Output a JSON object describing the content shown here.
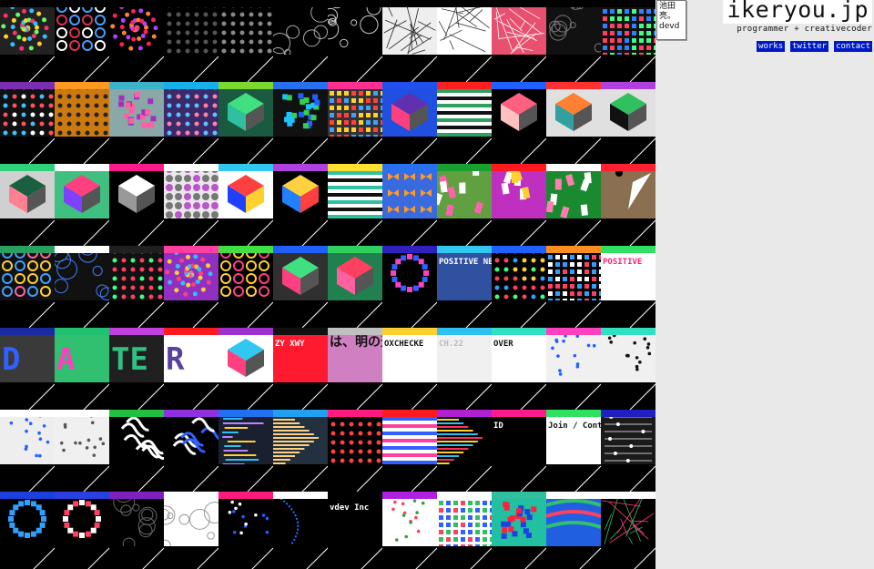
{
  "site": {
    "title": "ikeryou.jp",
    "subtitle": "programmer + creativecoder",
    "name_box": "池田亮。devd",
    "nav": [
      {
        "label": "works"
      },
      {
        "label": "twitter"
      },
      {
        "label": "contact"
      }
    ]
  },
  "grid": {
    "rows": [
      [
        {
          "bar": "#000000",
          "bg": "#222222",
          "kind": "spiral",
          "c": [
            "#ff3070",
            "#30c0ff",
            "#ffd030",
            "#60ff60"
          ]
        },
        {
          "bar": "#000000",
          "bg": "#000000",
          "kind": "rings",
          "c": [
            "#e03050",
            "#40a0ff",
            "#ffffff"
          ]
        },
        {
          "bar": "#000000",
          "bg": "#000000",
          "kind": "swirl",
          "c": [
            "#ff2050",
            "#b040ff",
            "#ff8030"
          ]
        },
        {
          "bar": "#000000",
          "bg": "#000000",
          "kind": "dots",
          "c": [
            "#555555"
          ]
        },
        {
          "bar": "#000000",
          "bg": "#000000",
          "kind": "dots",
          "c": [
            "#888888"
          ]
        },
        {
          "bar": "#000000",
          "bg": "#000000",
          "kind": "bubbles",
          "c": [
            "#aaaaaa"
          ]
        },
        {
          "bar": "#000000",
          "bg": "#000000",
          "kind": "bubbles",
          "c": [
            "#cccccc"
          ]
        },
        {
          "bar": "#000000",
          "bg": "#eeeeee",
          "kind": "mesh",
          "c": [
            "#222222"
          ]
        },
        {
          "bar": "#000000",
          "bg": "#ffffff",
          "kind": "mesh",
          "c": [
            "#333333"
          ]
        },
        {
          "bar": "#000000",
          "bg": "#e85070",
          "kind": "mesh",
          "c": [
            "#ffffff"
          ]
        },
        {
          "bar": "#000000",
          "bg": "#111111",
          "kind": "circles",
          "c": [
            "#777777"
          ]
        },
        {
          "bar": "#000000",
          "bg": "#111111",
          "kind": "grid",
          "c": [
            "#40ff80",
            "#ff4060",
            "#3080ff"
          ]
        }
      ],
      [
        {
          "bar": "#7a2fb0",
          "bg": "#111111",
          "kind": "dots",
          "c": [
            "#ff5060",
            "#40c0ff",
            "#ffffff"
          ]
        },
        {
          "bar": "#ff9a20",
          "bg": "#cc7a10",
          "kind": "dots",
          "c": [
            "#222222"
          ]
        },
        {
          "bar": "#3cb3c8",
          "bg": "#8aa8a8",
          "kind": "blob",
          "c": [
            "#a030c0",
            "#ff60a0"
          ]
        },
        {
          "bar": "#18b0e8",
          "bg": "#3a2a6a",
          "kind": "dots",
          "c": [
            "#ff80a0",
            "#60c0ff"
          ]
        },
        {
          "bar": "#7ad830",
          "bg": "#1a5a40",
          "kind": "iso",
          "c": [
            "#40e080",
            "#30c0a0"
          ]
        },
        {
          "bar": "#2870f0",
          "bg": "#111111",
          "kind": "puzzle",
          "c": [
            "#30d050",
            "#2060ff",
            "#20c0ff"
          ]
        },
        {
          "bar": "#ff3090",
          "bg": "#333333",
          "kind": "grid",
          "c": [
            "#ff4040",
            "#ffd030",
            "#40a0ff"
          ]
        },
        {
          "bar": "#2050f0",
          "bg": "#2050e0",
          "kind": "iso",
          "c": [
            "#6030b0",
            "#ff4080"
          ]
        },
        {
          "bar": "#ff2020",
          "bg": "#ffffff",
          "kind": "stripes",
          "c": [
            "#111111",
            "#30a060"
          ]
        },
        {
          "bar": "#2060ff",
          "bg": "#000000",
          "kind": "tower",
          "c": [
            "#ff6080",
            "#ffc0c0"
          ]
        },
        {
          "bar": "#ff3030",
          "bg": "#e0e0e0",
          "kind": "iso",
          "c": [
            "#ff8030",
            "#30a0a0"
          ]
        },
        {
          "bar": "#b040e0",
          "bg": "#e0e0e0",
          "kind": "iso",
          "c": [
            "#30c060",
            "#111111"
          ]
        }
      ],
      [
        {
          "bar": "#2ed27a",
          "bg": "#d0d0d0",
          "kind": "pyramid",
          "c": [
            "#1a6040",
            "#ff8090"
          ]
        },
        {
          "bar": "#ffffff",
          "bg": "#40c080",
          "kind": "iso",
          "c": [
            "#ff4080",
            "#8040ff"
          ]
        },
        {
          "bar": "#ff1a8c",
          "bg": "#000000",
          "kind": "cone",
          "c": [
            "#ffffff",
            "#999999"
          ]
        },
        {
          "bar": "#ffffff",
          "bg": "#e8e8e8",
          "kind": "halfdots",
          "c": [
            "#bb55cc",
            "#777777"
          ]
        },
        {
          "bar": "#30c8f0",
          "bg": "#ffffff",
          "kind": "iso",
          "c": [
            "#ff4040",
            "#2040ff",
            "#ffd030"
          ]
        },
        {
          "bar": "#b040e0",
          "bg": "#000000",
          "kind": "iso",
          "c": [
            "#ffd040",
            "#2080ff",
            "#ff4040"
          ]
        },
        {
          "bar": "#ffe030",
          "bg": "#ffffff",
          "kind": "stripes",
          "c": [
            "#111111",
            "#30c0a0"
          ]
        },
        {
          "bar": "#2870f0",
          "bg": "#3a6ae0",
          "kind": "bows",
          "c": [
            "#ff9a20"
          ]
        },
        {
          "bar": "#18a030",
          "bg": "#60a040",
          "kind": "bricks",
          "c": [
            "#ff60b0",
            "#ffffff"
          ]
        },
        {
          "bar": "#ff1a20",
          "bg": "#c030c0",
          "kind": "bricks",
          "c": [
            "#ffffff",
            "#ffd030"
          ]
        },
        {
          "bar": "#ffffff",
          "bg": "#1a8a30",
          "kind": "bricks",
          "c": [
            "#ffffff",
            "#ff80b0"
          ]
        },
        {
          "bar": "#ff2030",
          "bg": "#8a7050",
          "kind": "shards",
          "c": [
            "#ffffff",
            "#000000"
          ]
        }
      ],
      [
        {
          "bar": "#2aa060",
          "bg": "#111111",
          "kind": "rings",
          "c": [
            "#ff60a0",
            "#ffd030",
            "#40a0ff"
          ]
        },
        {
          "bar": "#ffffff",
          "bg": "#111111",
          "kind": "bubbles",
          "c": [
            "#4080ff"
          ]
        },
        {
          "bar": "#202020",
          "bg": "#111111",
          "kind": "dots",
          "c": [
            "#ff4060",
            "#40ff80"
          ]
        },
        {
          "bar": "#ff40a0",
          "bg": "#9030c0",
          "kind": "swirl",
          "c": [
            "#ffd030",
            "#30c0ff",
            "#ff4080"
          ]
        },
        {
          "bar": "#40e040",
          "bg": "#000000",
          "kind": "rings",
          "c": [
            "#ffd030",
            "#ff4080"
          ]
        },
        {
          "bar": "#2060ff",
          "bg": "#303030",
          "kind": "iso",
          "c": [
            "#40e080",
            "#ff4080"
          ]
        },
        {
          "bar": "#30d060",
          "bg": "#208050",
          "kind": "iso",
          "c": [
            "#ff4060",
            "#ff60a0"
          ]
        },
        {
          "bar": "#3020c0",
          "bg": "#000000",
          "kind": "ring",
          "c": [
            "#ff40c0",
            "#3060ff"
          ]
        },
        {
          "bar": "#30c8f0",
          "bg": "#3050a0",
          "kind": "textpattern",
          "c": [
            "#ffffff"
          ],
          "text": "POSITIVE NEGATIVE"
        },
        {
          "bar": "#2060ff",
          "bg": "#000000",
          "kind": "dots",
          "c": [
            "#ff4060",
            "#30a0ff",
            "#ffd030",
            "#40ff80"
          ]
        },
        {
          "bar": "#ff9020",
          "bg": "#000000",
          "kind": "grid",
          "c": [
            "#ff4060",
            "#30a0ff",
            "#ffffff"
          ]
        },
        {
          "bar": "#30e060",
          "bg": "#ffffff",
          "kind": "textpattern",
          "c": [
            "#ff2080",
            "#2040ff",
            "#30c030",
            "#ff8020"
          ],
          "text": "POSITIVE"
        }
      ],
      [
        {
          "bar": "#1a2aa0",
          "bg": "#3a3a3a",
          "kind": "bigletter",
          "c": [
            "#3060ff",
            "#ffffff"
          ],
          "text": "D"
        },
        {
          "bar": "#20c070",
          "bg": "#30c070",
          "kind": "bigletter",
          "c": [
            "#ff40c0",
            "#1a1a1a"
          ],
          "text": "A"
        },
        {
          "bar": "#c040e0",
          "bg": "#202020",
          "kind": "bigletter",
          "c": [
            "#30c080",
            "#ff4060"
          ],
          "text": "TE"
        },
        {
          "bar": "#ff1a20",
          "bg": "#ffffff",
          "kind": "bigletter",
          "c": [
            "#5a40a0",
            "#111111"
          ],
          "text": "R"
        },
        {
          "bar": "#a030d0",
          "bg": "#ffffff",
          "kind": "iso",
          "c": [
            "#30c8f0",
            "#ff4080"
          ]
        },
        {
          "bar": "#111111",
          "bg": "#ff1a30",
          "kind": "textpattern",
          "c": [
            "#ffffff"
          ],
          "text": "ZY XWY"
        },
        {
          "bar": "#c0c0c0",
          "bg": "#d080c0",
          "kind": "jptext",
          "c": [
            "#111111"
          ],
          "text": "は、明の天気"
        },
        {
          "bar": "#ffd030",
          "bg": "#ffffff",
          "kind": "textpattern",
          "c": [
            "#111111"
          ],
          "text": "OXCHECKE"
        },
        {
          "bar": "#30c0f0",
          "bg": "#f0f0f0",
          "kind": "textpattern",
          "c": [
            "#bbbbbb"
          ],
          "text": "CH.22"
        },
        {
          "bar": "#30e0c0",
          "bg": "#ffffff",
          "kind": "textpattern",
          "c": [
            "#111111"
          ],
          "text": "OVER"
        },
        {
          "bar": "#ff40c0",
          "bg": "#f0f0f0",
          "kind": "scatter",
          "c": [
            "#2060ff"
          ]
        },
        {
          "bar": "#30e0c0",
          "bg": "#f0f0f0",
          "kind": "scatter",
          "c": [
            "#111111"
          ]
        }
      ],
      [
        {
          "bar": "#ffffff",
          "bg": "#eeeeee",
          "kind": "scatter",
          "c": [
            "#2060ff"
          ]
        },
        {
          "bar": "#ffffff",
          "bg": "#f0f0f0",
          "kind": "scatter",
          "c": [
            "#555555"
          ]
        },
        {
          "bar": "#20c040",
          "bg": "#000000",
          "kind": "glyphs",
          "c": [
            "#ffffff"
          ]
        },
        {
          "bar": "#9030e0",
          "bg": "#000000",
          "kind": "glyphs",
          "c": [
            "#ffffff",
            "#3060ff"
          ]
        },
        {
          "bar": "#2070f0",
          "bg": "#1a2030",
          "kind": "code",
          "c": [
            "#30c0f0",
            "#ffd030",
            "#c080ff"
          ]
        },
        {
          "bar": "#20a0f0",
          "bg": "#223040",
          "kind": "bars",
          "c": [
            "#ffd080"
          ]
        },
        {
          "bar": "#ff1a80",
          "bg": "#000000",
          "kind": "dots",
          "c": [
            "#ff4040"
          ]
        },
        {
          "bar": "#ff1a20",
          "bg": "#ffffff",
          "kind": "stripes",
          "c": [
            "#ff40a0",
            "#3060ff"
          ]
        },
        {
          "bar": "#b020d0",
          "bg": "#000000",
          "kind": "bars",
          "c": [
            "#ff3060",
            "#ffd030",
            "#30c0f0"
          ]
        },
        {
          "bar": "#ff1a90",
          "bg": "#000000",
          "kind": "textpattern",
          "c": [
            "#ffffff"
          ],
          "text": "ID"
        },
        {
          "bar": "#30e060",
          "bg": "#ffffff",
          "kind": "menu",
          "c": [
            "#111111"
          ],
          "text": "Join / Contact"
        },
        {
          "bar": "#2020c0",
          "bg": "#1a1a1a",
          "kind": "sliders",
          "c": [
            "#ffffff"
          ]
        }
      ],
      [
        {
          "bar": "#1a40e0",
          "bg": "#000000",
          "kind": "ring",
          "c": [
            "#30a0ff"
          ]
        },
        {
          "bar": "#2a40e0",
          "bg": "#000000",
          "kind": "ring",
          "c": [
            "#ffffff",
            "#ff4060"
          ]
        },
        {
          "bar": "#8020c0",
          "bg": "#000000",
          "kind": "bubbles",
          "c": [
            "#666666"
          ]
        },
        {
          "bar": "#ffffff",
          "bg": "#ffffff",
          "kind": "bubbles",
          "c": [
            "#999999"
          ]
        },
        {
          "bar": "#ff1a80",
          "bg": "#000000",
          "kind": "scatter",
          "c": [
            "#ffffff",
            "#2060ff"
          ]
        },
        {
          "bar": "#ffffff",
          "bg": "#000000",
          "kind": "curve",
          "c": [
            "#2070ff"
          ]
        },
        {
          "bar": "#000000",
          "bg": "#000000",
          "kind": "textpattern",
          "c": [
            "#ffffff"
          ],
          "text": "vdev Inc"
        },
        {
          "bar": "#b020e0",
          "bg": "#ffffff",
          "kind": "scatter",
          "c": [
            "#ff4060",
            "#30a040"
          ]
        },
        {
          "bar": "#ffffff",
          "bg": "#ffffff",
          "kind": "grid",
          "c": [
            "#ff4060",
            "#3060ff",
            "#30c060"
          ]
        },
        {
          "bar": "#30c0a0",
          "bg": "#20c0a0",
          "kind": "blob",
          "c": [
            "#ff2040",
            "#2040e0"
          ]
        },
        {
          "bar": "#ffffff",
          "bg": "#2060e0",
          "kind": "waves",
          "c": [
            "#30c070",
            "#ff4060"
          ]
        },
        {
          "bar": "#ffffff",
          "bg": "#000000",
          "kind": "mesh",
          "c": [
            "#30c060",
            "#ff4080"
          ]
        }
      ]
    ]
  }
}
